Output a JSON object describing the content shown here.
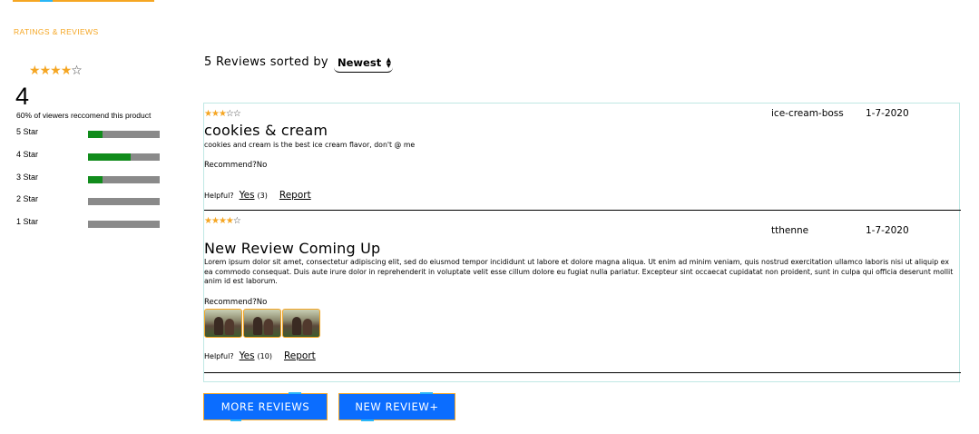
{
  "section_title": "RATINGS & REVIEWS",
  "summary": {
    "average": "4",
    "star_rating": 4,
    "recommend_text": "60% of viewers reccomend this product",
    "breakdown": [
      {
        "label": "5 Star",
        "fraction": 0.2
      },
      {
        "label": "4 Star",
        "fraction": 0.6
      },
      {
        "label": "3 Star",
        "fraction": 0.2
      },
      {
        "label": "2 Star",
        "fraction": 0
      },
      {
        "label": "1 Star",
        "fraction": 0
      }
    ]
  },
  "reviews_header": {
    "text": "5 Reviews sorted by",
    "sort_value": "Newest"
  },
  "reviews": [
    {
      "rating": 3,
      "reviewer": "ice-cream-boss",
      "date": "1-7-2020",
      "summary": "cookies & cream",
      "body": "cookies and cream is the best ice cream flavor, don't @ me",
      "recommend": "Recommend?No",
      "helpful_label": "Helpful?",
      "yes_label": "Yes",
      "helpful_count": "(3)",
      "report_label": "Report",
      "photos": 0
    },
    {
      "rating": 4,
      "reviewer": "tthenne",
      "date": "1-7-2020",
      "summary": "New Review Coming Up",
      "body": "Lorem ipsum dolor sit amet, consectetur adipiscing elit, sed do eiusmod tempor incididunt ut labore et dolore magna aliqua. Ut enim ad minim veniam, quis nostrud exercitation ullamco laboris nisi ut aliquip ex ea commodo consequat. Duis aute irure dolor in reprehenderit in voluptate velit esse cillum dolore eu fugiat nulla pariatur. Excepteur sint occaecat cupidatat non proident, sunt in culpa qui officia deserunt mollit anim id est laborum.",
      "recommend": "Recommend?No",
      "helpful_label": "Helpful?",
      "yes_label": "Yes",
      "helpful_count": "(10)",
      "report_label": "Report",
      "photos": 3
    }
  ],
  "buttons": {
    "more_reviews": "MORE REVIEWS",
    "new_review": "NEW REVIEW+"
  },
  "colors": {
    "accent": "#f5a623",
    "bar_fill": "#118c1c",
    "bar_track": "#8a8a8a",
    "button_bg": "#0b6dff"
  }
}
